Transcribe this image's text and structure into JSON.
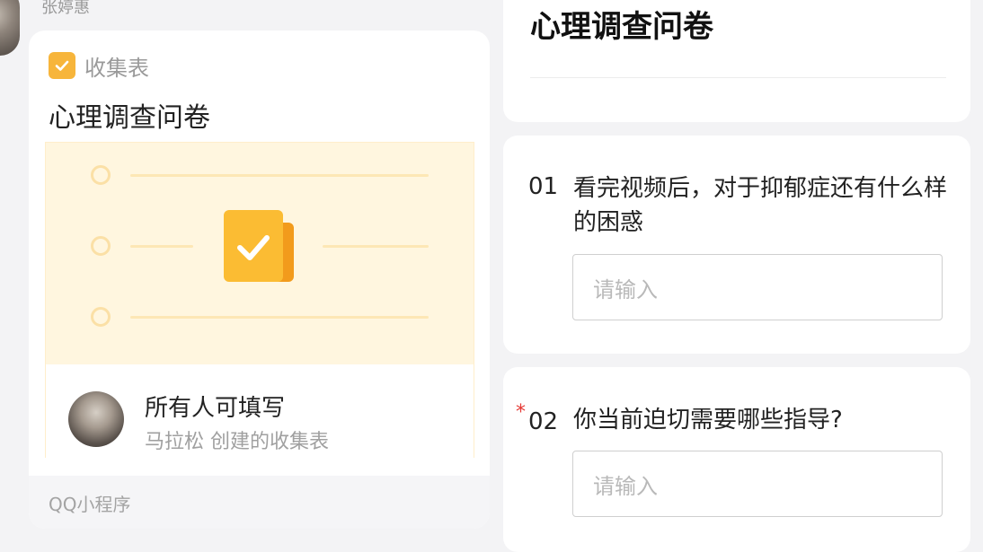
{
  "chat": {
    "sender_name": "张婷惠",
    "card": {
      "type_label": "收集表",
      "title": "心理调查问卷",
      "permission": "所有人可填写",
      "creator_line": "马拉松 创建的收集表",
      "footer": "QQ小程序"
    }
  },
  "form": {
    "title": "心理调查问卷",
    "questions": [
      {
        "number": "01",
        "required": false,
        "text": "看完视频后，对于抑郁症还有什么样的困惑",
        "placeholder": "请输入"
      },
      {
        "number": "02",
        "required": true,
        "required_mark": "*",
        "text": "你当前迫切需要哪些指导?",
        "placeholder": "请输入"
      }
    ]
  },
  "colors": {
    "accent": "#f7b53b",
    "illustration_bg": "#fff6df",
    "required": "#e53935"
  }
}
